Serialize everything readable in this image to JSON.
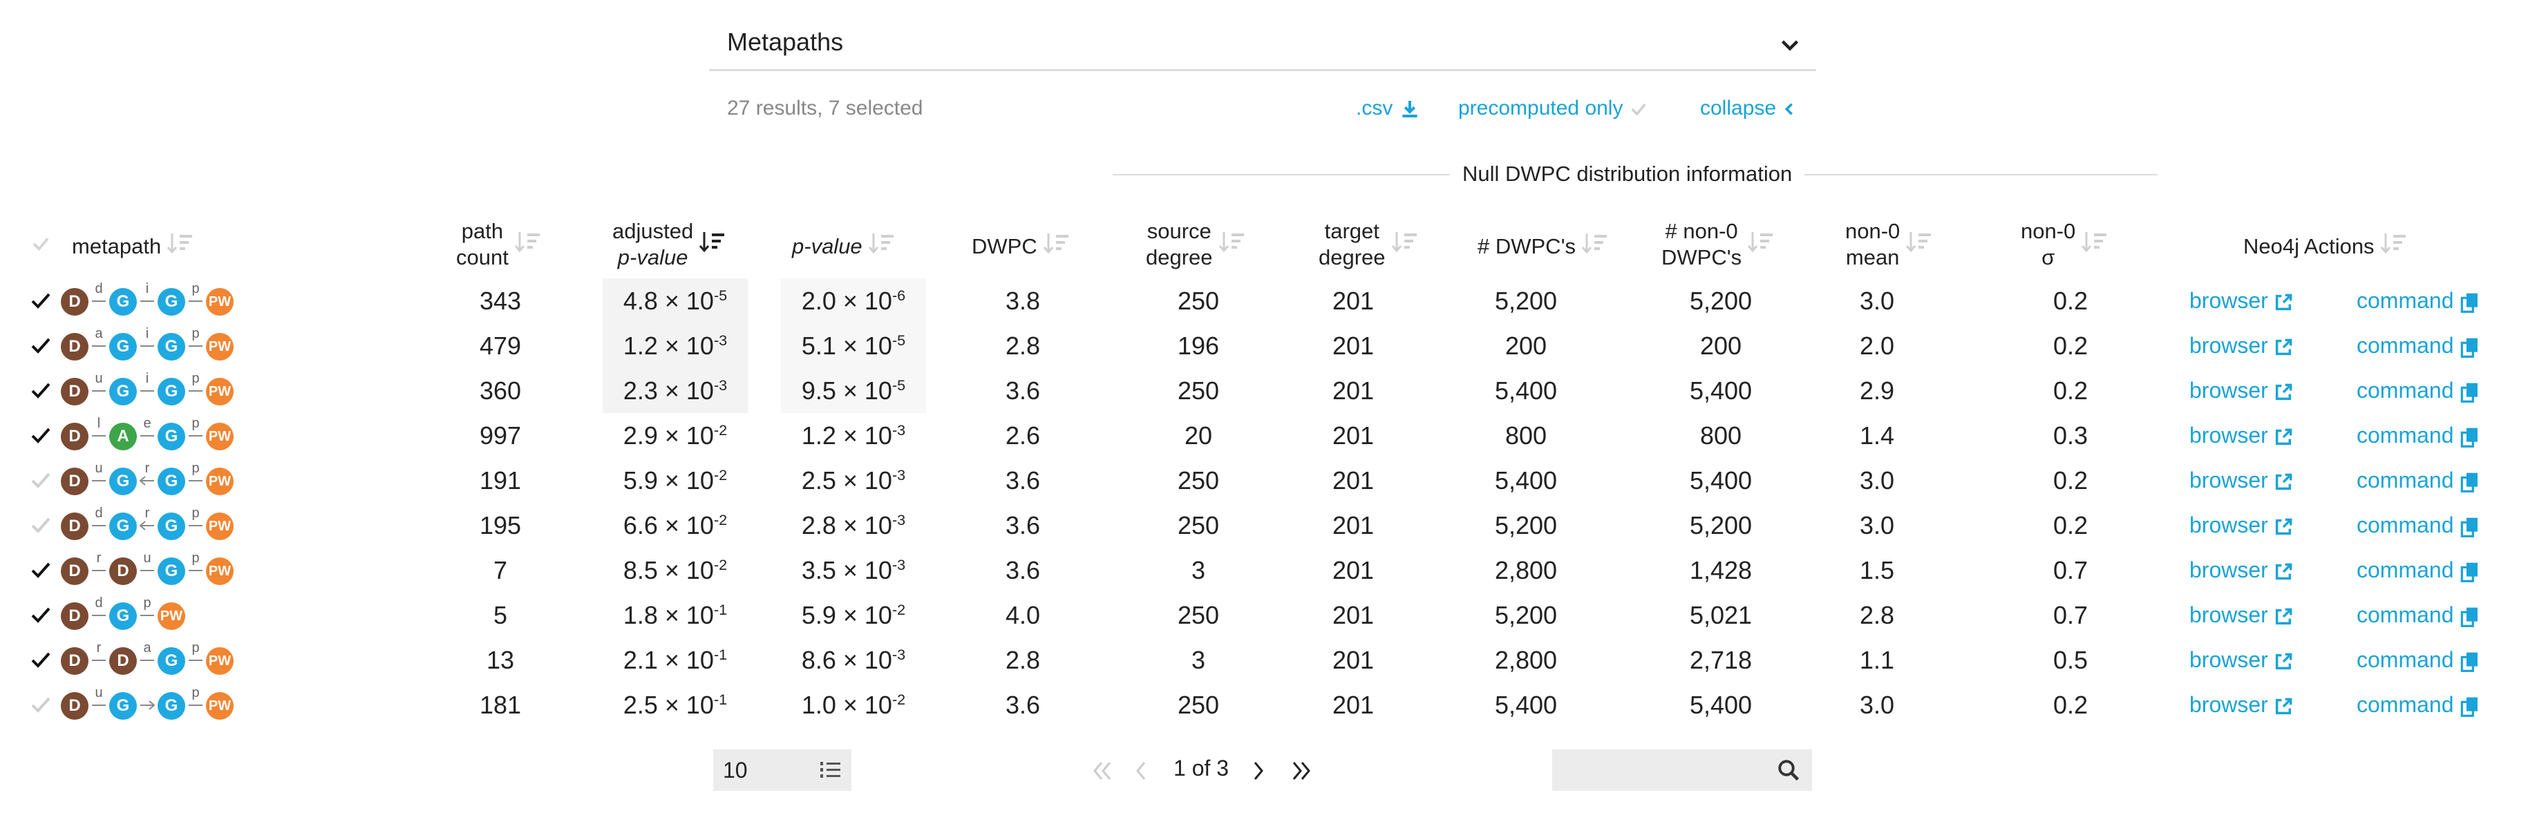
{
  "section": {
    "title": "Metapaths"
  },
  "summary": "27 results, 7 selected",
  "links": {
    "csv": ".csv",
    "precomputed": "precomputed only",
    "collapse": "collapse"
  },
  "null_dwpc_label": "Null DWPC distribution information",
  "headers": {
    "metapath": "metapath",
    "path_count": [
      "path",
      "count"
    ],
    "adjusted_pvalue": [
      "adjusted",
      "p-value"
    ],
    "pvalue": "p-value",
    "dwpc": "DWPC",
    "source_degree": [
      "source",
      "degree"
    ],
    "target_degree": [
      "target",
      "degree"
    ],
    "n_dwpc": "# DWPC's",
    "n_nonzero_dwpc": [
      "# non-0",
      "DWPC's"
    ],
    "nonzero_mean": [
      "non-0",
      "mean"
    ],
    "nonzero_sigma": [
      "non-0",
      "σ"
    ],
    "neo4j_actions": "Neo4j Actions"
  },
  "colors": {
    "disease": "#7b4a33",
    "gene": "#20a9e0",
    "anatomy": "#3ea54b",
    "pathway": "#f28531",
    "link": "#1aa3d8",
    "check_on": "#111111",
    "check_off": "#cfcfcf"
  },
  "rows": [
    {
      "selected": true,
      "metapath": [
        {
          "n": "D"
        },
        {
          "e": "d"
        },
        {
          "n": "G"
        },
        {
          "e": "i"
        },
        {
          "n": "G"
        },
        {
          "e": "p"
        },
        {
          "n": "PW"
        }
      ],
      "path_count": "343",
      "adj_p": {
        "m": "4.8",
        "x": "-5"
      },
      "p": {
        "m": "2.0",
        "x": "-6"
      },
      "dwpc": "3.8",
      "source_degree": "250",
      "target_degree": "201",
      "n_dwpc": "5,200",
      "n_nonzero": "5,200",
      "mean": "3.0",
      "sigma": "0.2",
      "browser": "browser",
      "command": "command"
    },
    {
      "selected": true,
      "metapath": [
        {
          "n": "D"
        },
        {
          "e": "a"
        },
        {
          "n": "G"
        },
        {
          "e": "i"
        },
        {
          "n": "G"
        },
        {
          "e": "p"
        },
        {
          "n": "PW"
        }
      ],
      "path_count": "479",
      "adj_p": {
        "m": "1.2",
        "x": "-3"
      },
      "p": {
        "m": "5.1",
        "x": "-5"
      },
      "dwpc": "2.8",
      "source_degree": "196",
      "target_degree": "201",
      "n_dwpc": "200",
      "n_nonzero": "200",
      "mean": "2.0",
      "sigma": "0.2",
      "browser": "browser",
      "command": "command"
    },
    {
      "selected": true,
      "metapath": [
        {
          "n": "D"
        },
        {
          "e": "u"
        },
        {
          "n": "G"
        },
        {
          "e": "i"
        },
        {
          "n": "G"
        },
        {
          "e": "p"
        },
        {
          "n": "PW"
        }
      ],
      "path_count": "360",
      "adj_p": {
        "m": "2.3",
        "x": "-3"
      },
      "p": {
        "m": "9.5",
        "x": "-5"
      },
      "dwpc": "3.6",
      "source_degree": "250",
      "target_degree": "201",
      "n_dwpc": "5,400",
      "n_nonzero": "5,400",
      "mean": "2.9",
      "sigma": "0.2",
      "browser": "browser",
      "command": "command"
    },
    {
      "selected": true,
      "metapath": [
        {
          "n": "D"
        },
        {
          "e": "l"
        },
        {
          "n": "A"
        },
        {
          "e": "e"
        },
        {
          "n": "G"
        },
        {
          "e": "p"
        },
        {
          "n": "PW"
        }
      ],
      "path_count": "997",
      "adj_p": {
        "m": "2.9",
        "x": "-2"
      },
      "p": {
        "m": "1.2",
        "x": "-3"
      },
      "dwpc": "2.6",
      "source_degree": "20",
      "target_degree": "201",
      "n_dwpc": "800",
      "n_nonzero": "800",
      "mean": "1.4",
      "sigma": "0.3",
      "browser": "browser",
      "command": "command"
    },
    {
      "selected": false,
      "metapath": [
        {
          "n": "D"
        },
        {
          "e": "u"
        },
        {
          "n": "G"
        },
        {
          "e": "r",
          "dir": "left"
        },
        {
          "n": "G"
        },
        {
          "e": "p"
        },
        {
          "n": "PW"
        }
      ],
      "path_count": "191",
      "adj_p": {
        "m": "5.9",
        "x": "-2"
      },
      "p": {
        "m": "2.5",
        "x": "-3"
      },
      "dwpc": "3.6",
      "source_degree": "250",
      "target_degree": "201",
      "n_dwpc": "5,400",
      "n_nonzero": "5,400",
      "mean": "3.0",
      "sigma": "0.2",
      "browser": "browser",
      "command": "command"
    },
    {
      "selected": false,
      "metapath": [
        {
          "n": "D"
        },
        {
          "e": "d"
        },
        {
          "n": "G"
        },
        {
          "e": "r",
          "dir": "left"
        },
        {
          "n": "G"
        },
        {
          "e": "p"
        },
        {
          "n": "PW"
        }
      ],
      "path_count": "195",
      "adj_p": {
        "m": "6.6",
        "x": "-2"
      },
      "p": {
        "m": "2.8",
        "x": "-3"
      },
      "dwpc": "3.6",
      "source_degree": "250",
      "target_degree": "201",
      "n_dwpc": "5,200",
      "n_nonzero": "5,200",
      "mean": "3.0",
      "sigma": "0.2",
      "browser": "browser",
      "command": "command"
    },
    {
      "selected": true,
      "metapath": [
        {
          "n": "D"
        },
        {
          "e": "r"
        },
        {
          "n": "D"
        },
        {
          "e": "u"
        },
        {
          "n": "G"
        },
        {
          "e": "p"
        },
        {
          "n": "PW"
        }
      ],
      "path_count": "7",
      "adj_p": {
        "m": "8.5",
        "x": "-2"
      },
      "p": {
        "m": "3.5",
        "x": "-3"
      },
      "dwpc": "3.6",
      "source_degree": "3",
      "target_degree": "201",
      "n_dwpc": "2,800",
      "n_nonzero": "1,428",
      "mean": "1.5",
      "sigma": "0.7",
      "browser": "browser",
      "command": "command"
    },
    {
      "selected": true,
      "metapath": [
        {
          "n": "D"
        },
        {
          "e": "d"
        },
        {
          "n": "G"
        },
        {
          "e": "p"
        },
        {
          "n": "PW"
        }
      ],
      "path_count": "5",
      "adj_p": {
        "m": "1.8",
        "x": "-1"
      },
      "p": {
        "m": "5.9",
        "x": "-2"
      },
      "dwpc": "4.0",
      "source_degree": "250",
      "target_degree": "201",
      "n_dwpc": "5,200",
      "n_nonzero": "5,021",
      "mean": "2.8",
      "sigma": "0.7",
      "browser": "browser",
      "command": "command"
    },
    {
      "selected": true,
      "metapath": [
        {
          "n": "D"
        },
        {
          "e": "r"
        },
        {
          "n": "D"
        },
        {
          "e": "a"
        },
        {
          "n": "G"
        },
        {
          "e": "p"
        },
        {
          "n": "PW"
        }
      ],
      "path_count": "13",
      "adj_p": {
        "m": "2.1",
        "x": "-1"
      },
      "p": {
        "m": "8.6",
        "x": "-3"
      },
      "dwpc": "2.8",
      "source_degree": "3",
      "target_degree": "201",
      "n_dwpc": "2,800",
      "n_nonzero": "2,718",
      "mean": "1.1",
      "sigma": "0.5",
      "browser": "browser",
      "command": "command"
    },
    {
      "selected": false,
      "metapath": [
        {
          "n": "D"
        },
        {
          "e": "u"
        },
        {
          "n": "G"
        },
        {
          "e": "",
          "dir": "right"
        },
        {
          "n": "G"
        },
        {
          "e": "p"
        },
        {
          "n": "PW"
        }
      ],
      "path_count": "181",
      "adj_p": {
        "m": "2.5",
        "x": "-1"
      },
      "p": {
        "m": "1.0",
        "x": "-2"
      },
      "dwpc": "3.6",
      "source_degree": "250",
      "target_degree": "201",
      "n_dwpc": "5,400",
      "n_nonzero": "5,400",
      "mean": "3.0",
      "sigma": "0.2",
      "browser": "browser",
      "command": "command"
    }
  ],
  "pagination": {
    "page_size": "10",
    "page_label": "1 of 3"
  },
  "search": {
    "placeholder": ""
  }
}
